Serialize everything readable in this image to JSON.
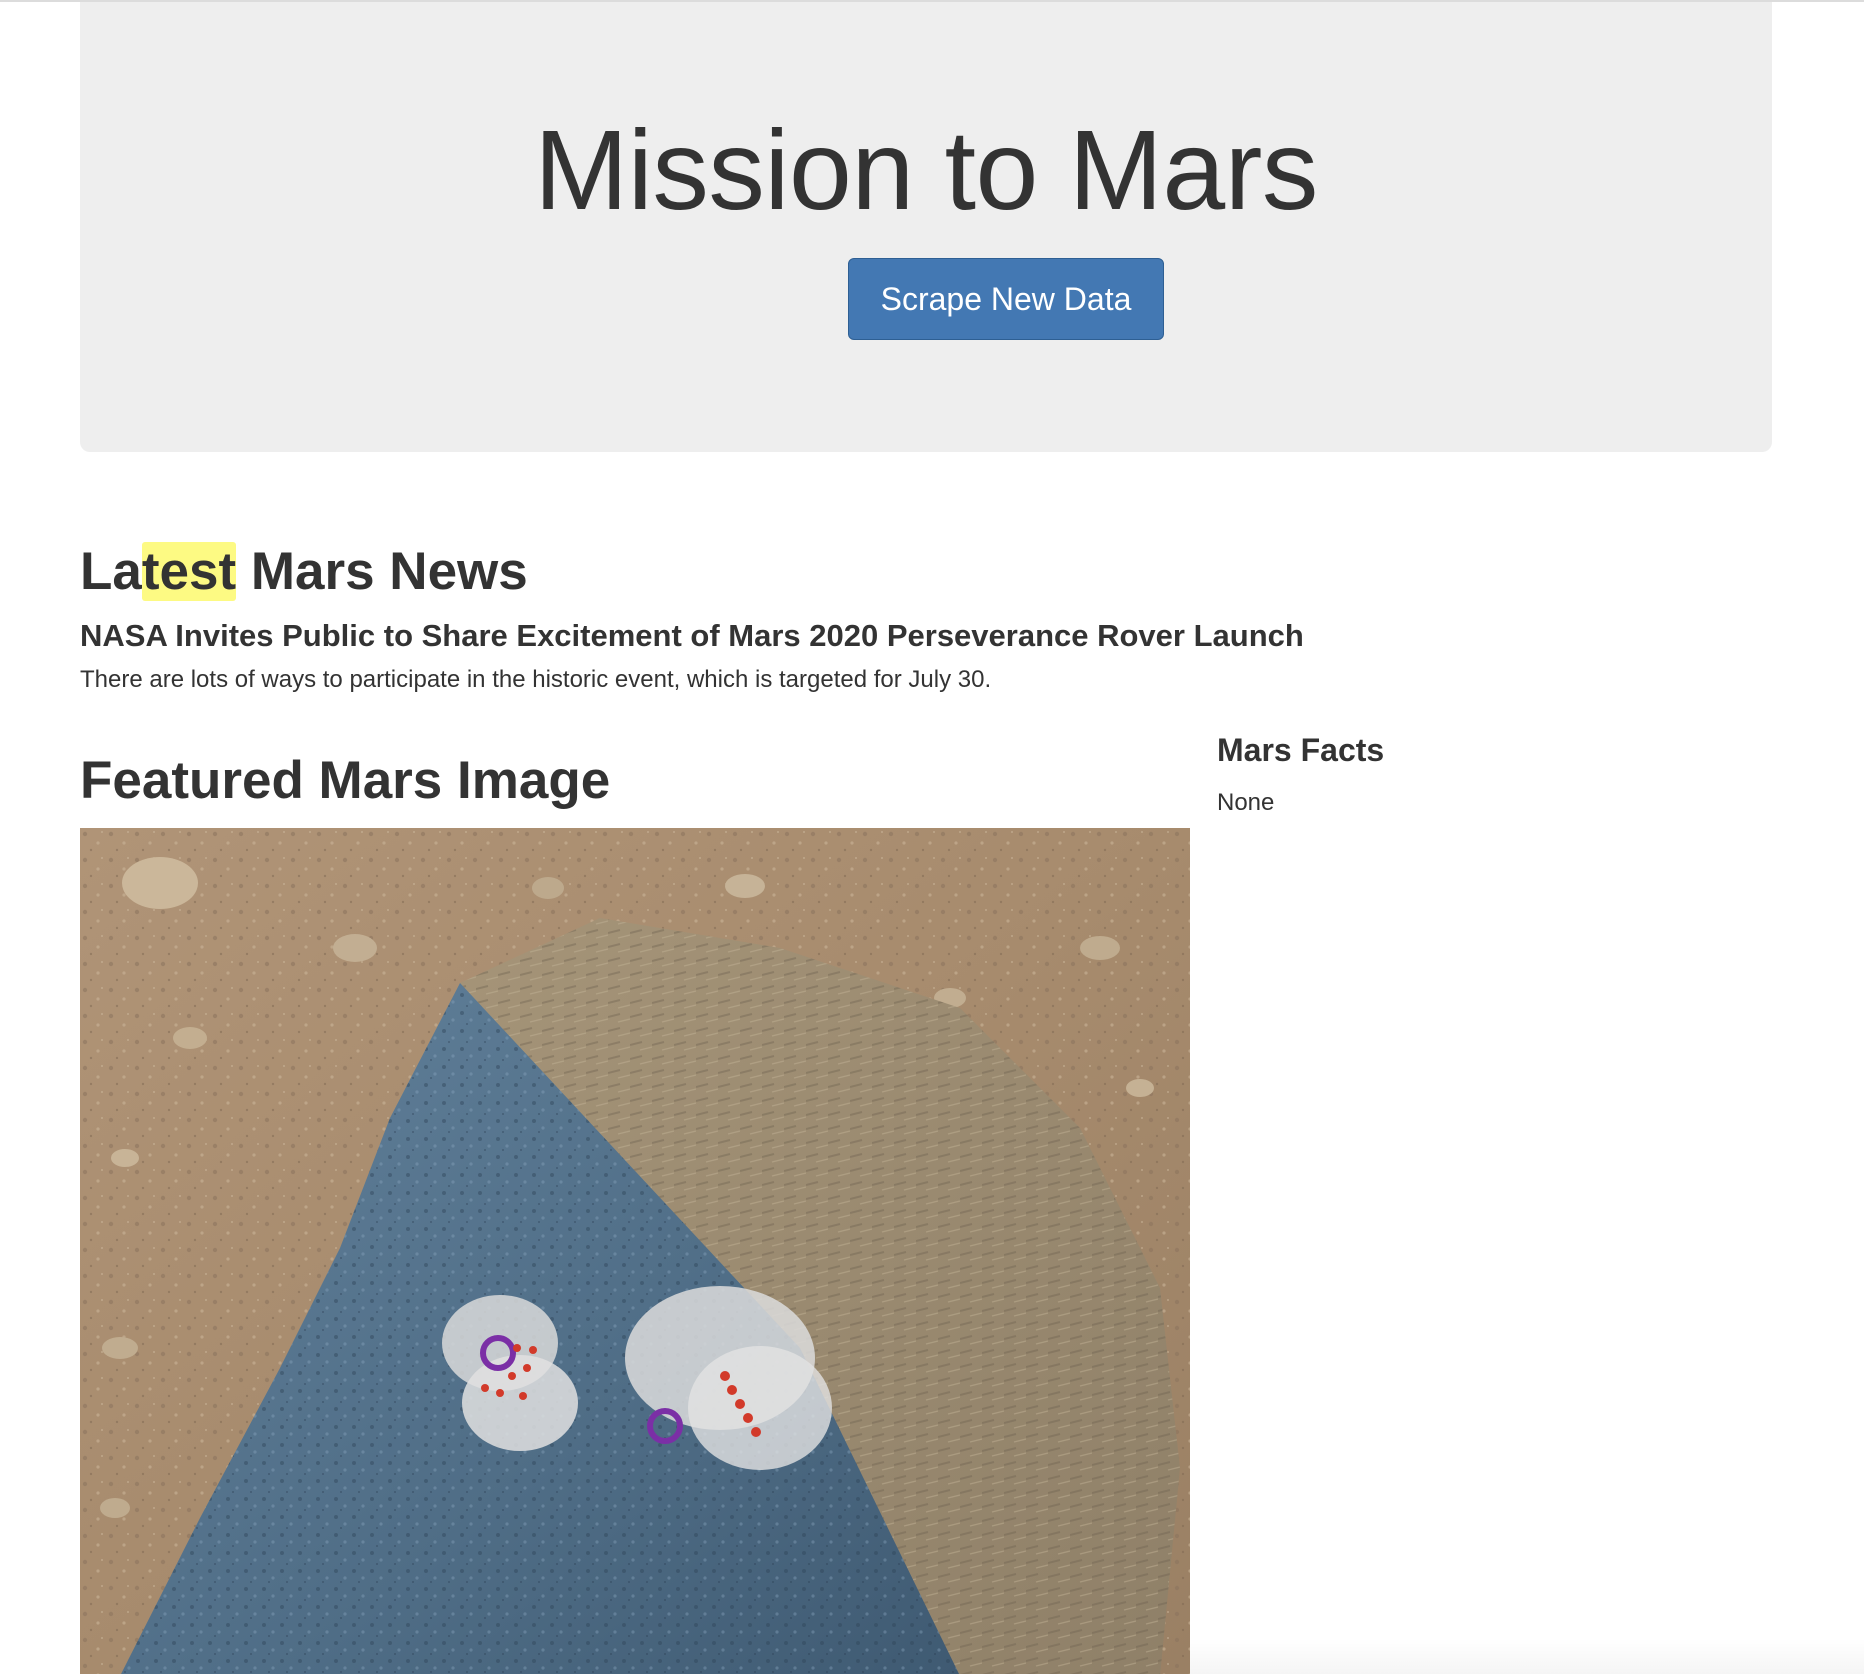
{
  "jumbotron": {
    "title": "Mission to Mars",
    "scrape_button_label": "Scrape New Data"
  },
  "news": {
    "heading_before": "La",
    "heading_highlight": "test",
    "heading_after": " Mars News",
    "title": "NASA Invites Public to Share Excitement of Mars 2020 Perseverance Rover Launch",
    "teaser": "There are lots of ways to participate in the historic event, which is targeted for July 30."
  },
  "featured": {
    "heading": "Featured Mars Image"
  },
  "facts": {
    "heading": "Mars Facts",
    "content": "None"
  },
  "colors": {
    "jumbotron_bg": "#eeeeee",
    "button_bg": "#4378b3",
    "highlight": "#fdfa83",
    "text": "#333333"
  }
}
